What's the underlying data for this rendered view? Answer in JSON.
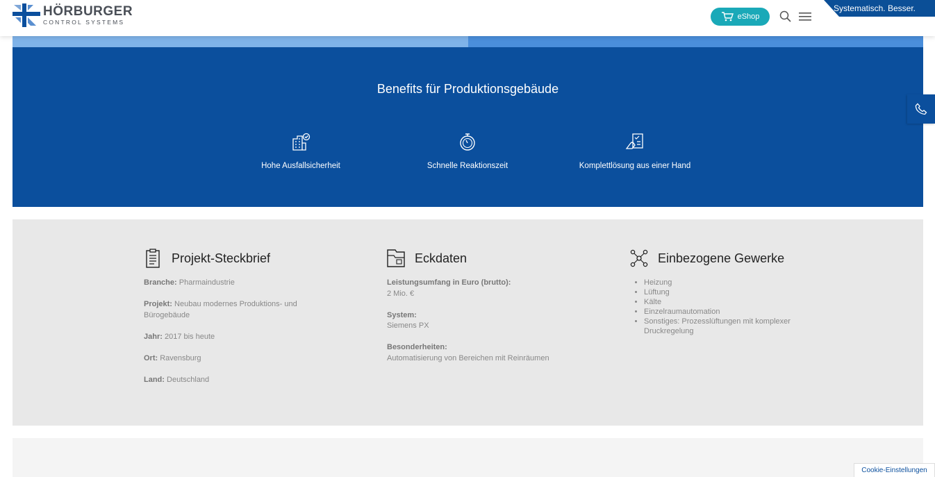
{
  "header": {
    "logo_name": "HÖRBURGER",
    "logo_sub": "CONTROL SYSTEMS",
    "eshop_label": "eShop",
    "tagline": "Systematisch. Besser."
  },
  "benefits": {
    "title": "Benefits für Produktionsgebäude",
    "items": [
      {
        "label": "Hohe Ausfallsicherheit",
        "icon": "building-check-icon"
      },
      {
        "label": "Schnelle Reaktionszeit",
        "icon": "stopwatch-icon"
      },
      {
        "label": "Komplettlösung aus einer Hand",
        "icon": "hand-checklist-icon"
      }
    ]
  },
  "steckbrief": {
    "title": "Projekt-Steckbrief",
    "branche_label": "Branche:",
    "branche_value": "Pharmaindustrie",
    "projekt_label": "Projekt:",
    "projekt_value": "Neubau modernes Produktions- und Bürogebäude",
    "jahr_label": "Jahr:",
    "jahr_value": "2017 bis heute",
    "ort_label": "Ort:",
    "ort_value": "Ravensburg",
    "land_label": "Land:",
    "land_value": "Deutschland"
  },
  "eckdaten": {
    "title": "Eckdaten",
    "umfang_label": "Leistungsumfang in Euro (brutto):",
    "umfang_value": "2 Mio. €",
    "system_label": "System:",
    "system_value": "Siemens PX",
    "besonderheiten_label": "Besonderheiten:",
    "besonderheiten_value": "Automatisierung von Bereichen mit Reinräumen"
  },
  "gewerke": {
    "title": "Einbezogene Gewerke",
    "items": [
      "Heizung",
      "Lüftung",
      "Kälte",
      "Einzelraumautomation",
      "Sonstiges: Prozesslüftungen mit komplexer Druckregelung"
    ]
  },
  "cookie_label": "Cookie-Einstellungen",
  "colors": {
    "brand_blue": "#0b4f9d",
    "eshop_teal": "#1aa9b8"
  }
}
